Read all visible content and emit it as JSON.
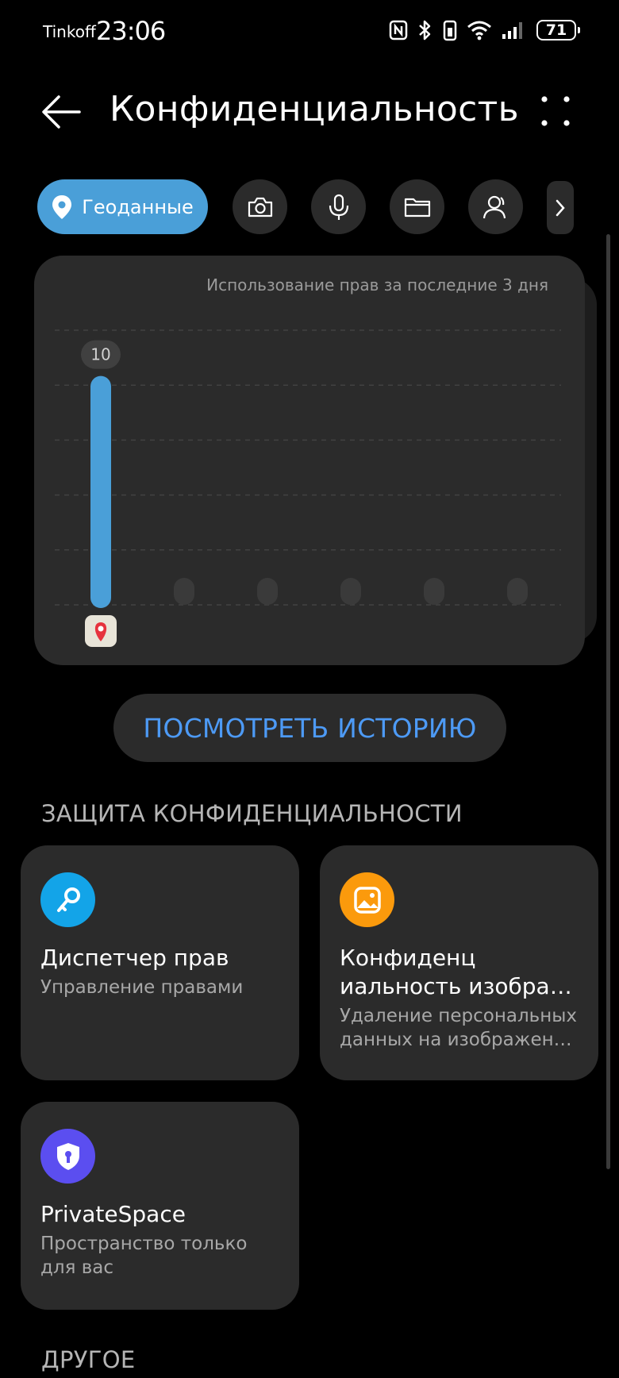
{
  "status_bar": {
    "carrier": "Tinkoff",
    "time": "23:06",
    "battery": "71",
    "icons": [
      "nfc-icon",
      "bluetooth-icon",
      "vibrate-icon",
      "wifi-icon",
      "signal-icon",
      "battery-icon"
    ]
  },
  "header": {
    "title": "Конфиденциальность",
    "back_icon": "arrow-left-icon",
    "more_icon": "more-dots-icon"
  },
  "categories": {
    "active_label": "Геоданные",
    "items": [
      "location-icon",
      "camera-icon",
      "microphone-icon",
      "folder-icon",
      "contacts-icon",
      "chevron-right-icon"
    ]
  },
  "usage_card": {
    "caption": "Использование прав за последние 3 дня",
    "top_value_label": "10",
    "bar_icon": "maps-app-icon"
  },
  "chart_data": {
    "type": "bar",
    "categories": [
      "maps-app",
      "",
      "",
      "",
      "",
      ""
    ],
    "values": [
      10,
      0,
      0,
      0,
      0,
      0
    ],
    "ylim": [
      0,
      12
    ],
    "grid": true,
    "colors": {
      "active": "#4a9fd8",
      "inactive": "#3a3a3a"
    }
  },
  "history_button": {
    "label": "ПОСМОТРЕТЬ ИСТОРИЮ"
  },
  "protection": {
    "section_title": "ЗАЩИТА КОНФИДЕНЦИАЛЬНОСТИ",
    "tiles": [
      {
        "icon": "key-icon",
        "title": "Диспетчер прав",
        "subtitle": "Управление правами",
        "icon_color": "#13a4e8"
      },
      {
        "icon": "image-icon",
        "title_line1": "Конфиденц",
        "title_line2": "иальность изобра…",
        "subtitle_line1": "Удаление персональных",
        "subtitle_line2": "данных на изображен…",
        "icon_color": "#fb9a0c"
      },
      {
        "icon": "shield-lock-icon",
        "title": "PrivateSpace",
        "subtitle_line1": "Пространство только",
        "subtitle_line2": "для вас",
        "icon_color": "#5b4ef0"
      }
    ]
  },
  "other": {
    "section_title": "ДРУГОЕ"
  }
}
